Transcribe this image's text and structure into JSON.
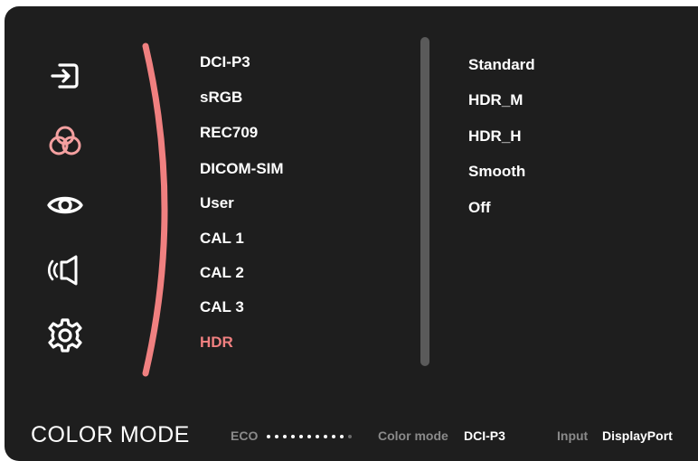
{
  "sidebar": {
    "icons": [
      "input-icon",
      "color-icon",
      "eye-icon",
      "audio-icon",
      "settings-icon"
    ],
    "active_index": 1
  },
  "menu": {
    "items": [
      "DCI-P3",
      "sRGB",
      "REC709",
      "DICOM-SIM",
      "User",
      "CAL 1",
      "CAL 2",
      "CAL 3",
      "HDR"
    ],
    "selected": "HDR"
  },
  "submenu": {
    "items": [
      "Standard",
      "HDR_M",
      "HDR_H",
      "Smooth",
      "Off"
    ]
  },
  "footer": {
    "title": "COLOR MODE",
    "eco_label": "ECO",
    "eco_level": {
      "filled": 10,
      "total": 11
    },
    "color_mode_label": "Color mode",
    "color_mode_value": "DCI-P3",
    "input_label": "Input",
    "input_value": "DisplayPort"
  },
  "colors": {
    "background": "#1e1e1e",
    "accent": "#f08080",
    "text": "#ffffff",
    "muted": "#8a8a8a"
  }
}
